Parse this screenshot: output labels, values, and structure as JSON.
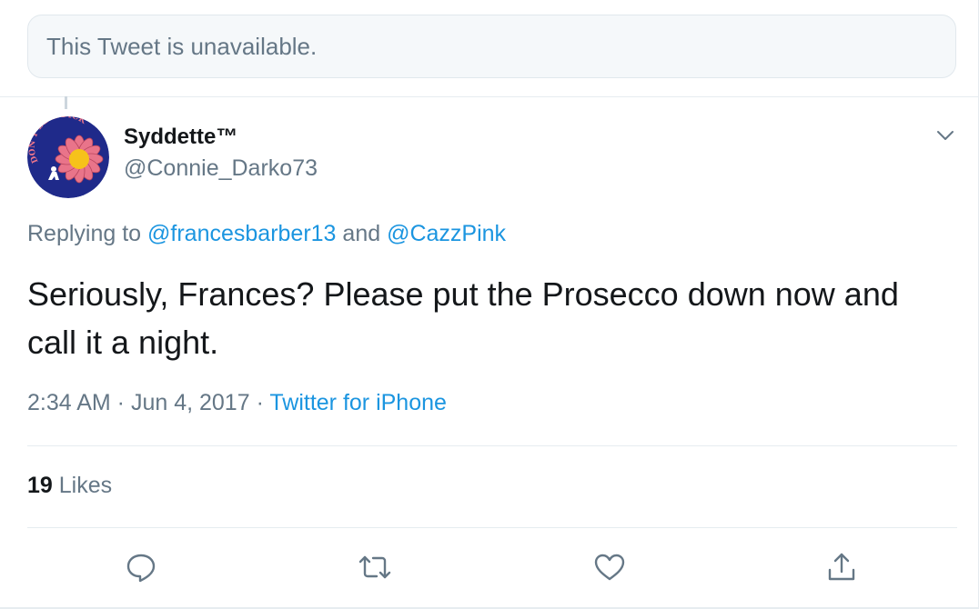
{
  "unavailable": {
    "text": "This Tweet is unavailable."
  },
  "author": {
    "name": "Syddette™",
    "handle": "@Connie_Darko73",
    "avatar_text": "DON'T BE A DICK"
  },
  "reply": {
    "prefix": "Replying to ",
    "mention_1": "@francesbarber13",
    "conjunction": " and ",
    "mention_2": "@CazzPink"
  },
  "tweet": {
    "text": "Seriously, Frances? Please put the Prosecco down now and call it a night."
  },
  "meta": {
    "time": "2:34 AM",
    "separator": " · ",
    "date": "Jun 4, 2017",
    "source": "Twitter for iPhone"
  },
  "stats": {
    "likes_count": "19",
    "likes_label": " Likes"
  },
  "actions": [
    "reply-icon",
    "retweet-icon",
    "like-icon",
    "share-icon"
  ],
  "colors": {
    "link": "#1b95e0",
    "secondary_text": "#657786",
    "primary_text": "#14171a",
    "border": "#e6ecf0",
    "avatar_bg": "#1f2a8a",
    "avatar_flower": "#e9748a"
  }
}
